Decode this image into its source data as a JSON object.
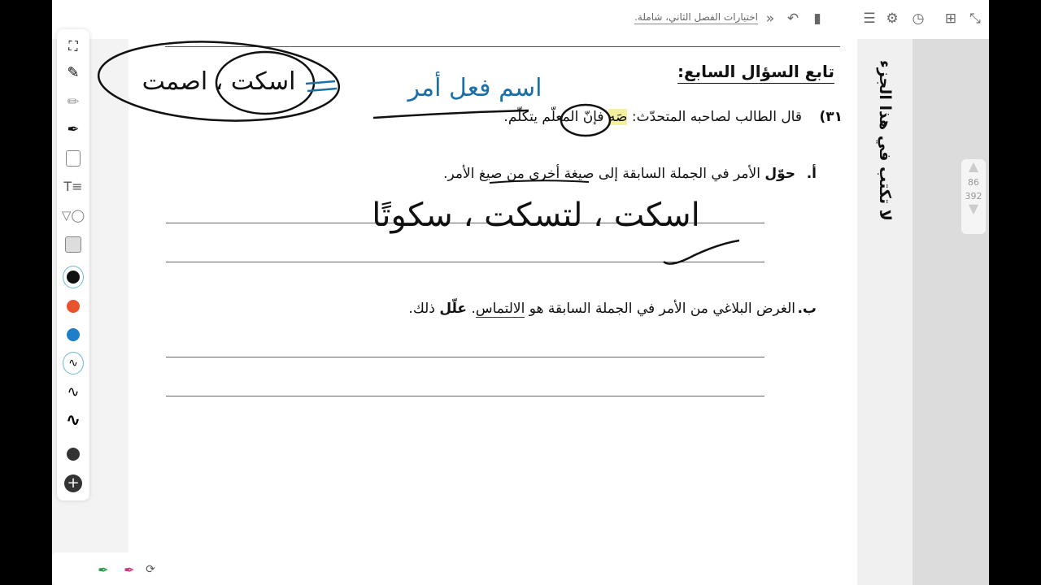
{
  "topbar": {
    "breadcrumb": "اختبارات الفصل الثاني، شاملة.",
    "icons": [
      "fullscreen-icon",
      "add-page-icon",
      "history-icon",
      "settings-icon",
      "outline-icon",
      "bookmark-icon",
      "undo-icon",
      "chevrons-icon"
    ]
  },
  "side": {
    "note": "لا تكتب في هذا الجزء",
    "page_current": "86",
    "page_total": "392"
  },
  "toolbar": {
    "colors": {
      "black": "#111111",
      "orange": "#e8532e",
      "blue": "#1e7fc8",
      "gray_dot": "#333333"
    }
  },
  "doc": {
    "heading": "تابع السؤال السابع:",
    "q_number": "٣١)",
    "q_text_before": "قال الطالب لصاحبه المتحدّث: ",
    "q_highlight": "صَه",
    "q_text_after": " فإنّ المعلّم يتكلّم.",
    "part_a_letter": "أ.",
    "part_a_bold": "حوّل",
    "part_a_text": " الأمر في الجملة السابقة إلى صيغة أخرى من صيغ الأمر.",
    "part_b_letter": "ب.",
    "part_b_text1": "الغرض البلاغي من الأمر في الجملة السابقة هو ",
    "part_b_underlined": "الالتماس",
    "part_b_text2": ". ",
    "part_b_bold": "علّل",
    "part_b_text3": " ذلك."
  },
  "handwriting": {
    "top_circle_text": "اسكت ، اصمت",
    "top_blue_text": "اسم فعل أمر",
    "answer_a_text": "اسكت ، لتسكت ، سكوتًا"
  }
}
